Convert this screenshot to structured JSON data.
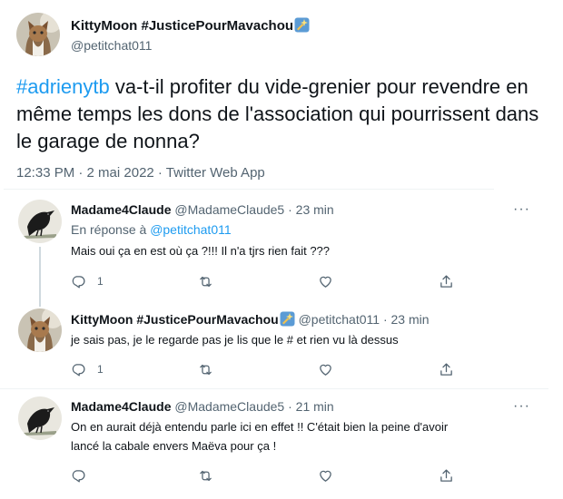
{
  "main_tweet": {
    "display_name": "KittyMoon #JusticePourMavachou",
    "handle": "@petitchat011",
    "hashtag": "#adrienytb",
    "text_rest": " va-t-il profiter du vide-grenier pour revendre en même temps les dons de l'association qui pourrissent dans le garage de nonna?",
    "meta": "12:33 PM · 2 mai 2022 · Twitter Web App"
  },
  "replies": [
    {
      "display_name": "Madame4Claude",
      "handle": "@MadameClaude5",
      "time": "· 23 min",
      "reply_prefix": "En réponse à",
      "reply_to": "@petitchat011",
      "text": "Mais oui ça en est où ça ?!!! Il n'a tjrs rien fait ???",
      "reply_count": "1"
    },
    {
      "display_name": "KittyMoon #JusticePourMavachou",
      "handle": "@petitchat011",
      "time": "· 23 min",
      "text": "je sais pas, je le regarde pas je lis que le # et rien vu là dessus",
      "reply_count": "1"
    },
    {
      "display_name": "Madame4Claude",
      "handle": "@MadameClaude5",
      "time": "· 21 min",
      "text_line1": "On en aurait déjà entendu parle ici en effet !! C'était bien la peine d'avoir",
      "text_line2": "lancé la cabale envers Maëva pour ça !",
      "reply_count": ""
    }
  ],
  "more_label": "···",
  "icons": [
    "reply-icon",
    "retweet-icon",
    "like-icon",
    "share-icon",
    "more-icon",
    "badge-icon"
  ],
  "colors": {
    "link": "#1d9bf0",
    "muted": "#536471",
    "text": "#0f1419"
  }
}
